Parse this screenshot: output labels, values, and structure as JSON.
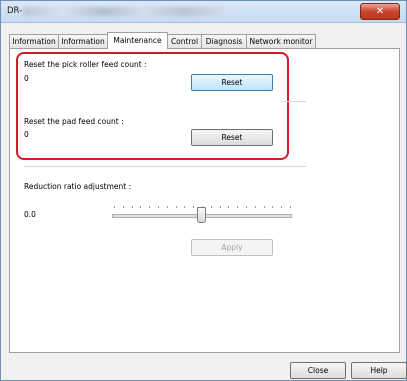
{
  "window": {
    "title_prefix": "DR-",
    "close_icon": "close-icon"
  },
  "tabs": [
    {
      "label": "Information",
      "active": false
    },
    {
      "label": "Information",
      "active": false
    },
    {
      "label": "Maintenance",
      "active": true
    },
    {
      "label": "Control",
      "active": false
    },
    {
      "label": "Diagnosis",
      "active": false
    },
    {
      "label": "Network monitor",
      "active": false
    }
  ],
  "maintenance": {
    "pick_roller_label": "Reset the pick roller feed count :",
    "pick_roller_value": "0",
    "pick_roller_button": "Reset",
    "pad_label": "Reset the pad feed count :",
    "pad_value": "0",
    "pad_button": "Reset",
    "reduction_label": "Reduction ratio adjustment :",
    "reduction_value": "0.0",
    "apply_button": "Apply"
  },
  "footer": {
    "close_button": "Close",
    "help_button": "Help"
  },
  "colors": {
    "highlight": "#d7192a",
    "focus_button": "#bee6fd"
  }
}
